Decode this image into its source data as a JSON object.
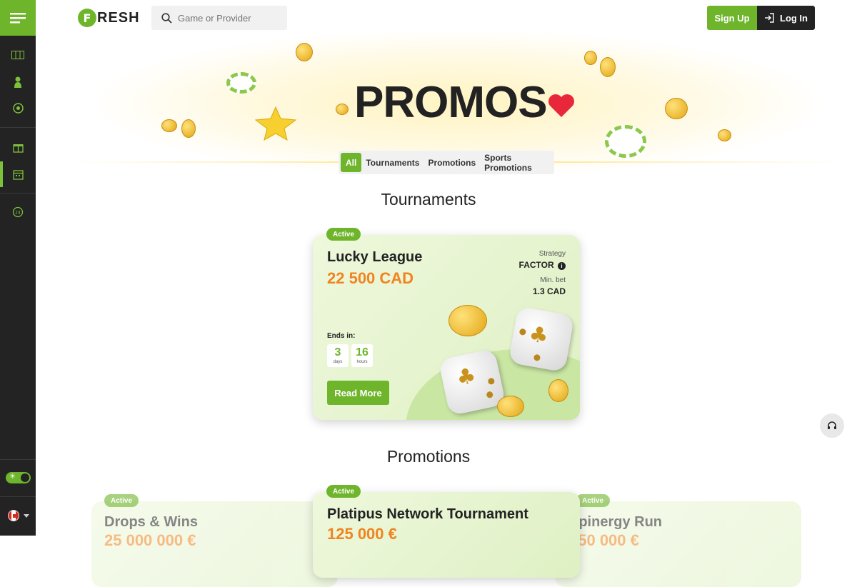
{
  "header": {
    "logo_letter": "F",
    "logo_text": "RESH",
    "search_placeholder": "Game or Provider",
    "signup_label": "Sign Up",
    "login_label": "Log In"
  },
  "hero": {
    "title": "PROMOS"
  },
  "filters": [
    {
      "label": "All",
      "active": true
    },
    {
      "label": "Tournaments",
      "active": false
    },
    {
      "label": "Promotions",
      "active": false
    },
    {
      "label": "Sports Promotions",
      "active": false
    }
  ],
  "sections": {
    "tournaments": "Tournaments",
    "promotions": "Promotions"
  },
  "tournament_card": {
    "badge": "Active",
    "title": "Lucky League",
    "prize": "22 500 CAD",
    "strategy_label": "Strategy",
    "strategy_value": "FACTOR",
    "min_bet_label": "Min. bet",
    "min_bet_value": "1.3 CAD",
    "ends_label": "Ends in:",
    "days_value": "3",
    "days_unit": "days",
    "hours_value": "16",
    "hours_unit": "hours",
    "button": "Read More"
  },
  "promo_cards": [
    {
      "badge": "Active",
      "title": "Drops & Wins",
      "prize": "25 000 000 €"
    },
    {
      "badge": "Active",
      "title": "Platipus Network Tournament",
      "prize": "125 000 €"
    },
    {
      "badge": "Active",
      "title": "Spinergy Run",
      "prize": "250 000 €"
    }
  ],
  "colors": {
    "brand_green": "#6fb52c",
    "sidebar_bg": "#232323",
    "prize_orange": "#f0841f"
  },
  "sidebar_icons": [
    "menu-icon",
    "slots-icon",
    "live-dealer-icon",
    "sports-icon",
    "gift-icon",
    "calendar-icon",
    "support-24-icon"
  ]
}
